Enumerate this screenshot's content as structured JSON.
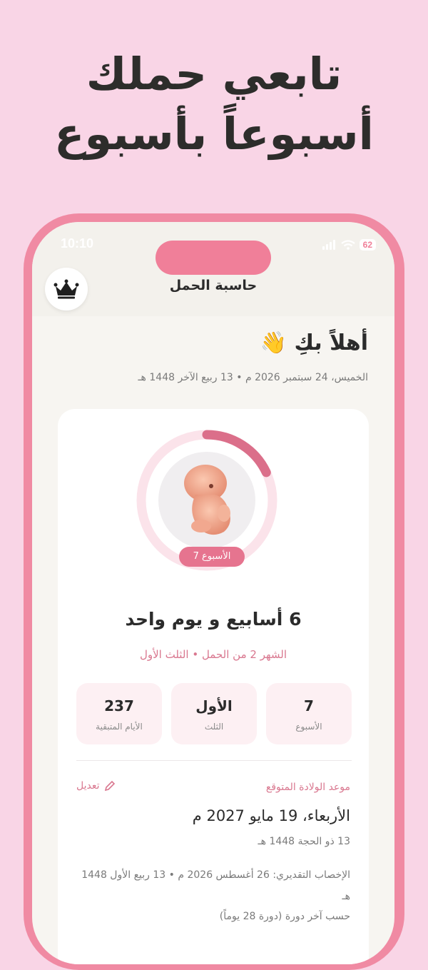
{
  "headline": {
    "line1": "تابعي حملك",
    "line2": "أسبوعاً بأسبوع"
  },
  "status_bar": {
    "time": "10:10",
    "battery": "62"
  },
  "app": {
    "title": "حاسبة الحمل",
    "crown_icon": "crown-icon"
  },
  "greeting": {
    "text": "أهلاً بكِ",
    "emoji": "👋"
  },
  "date_line": "الخميس، 24 سبتمبر 2026 م • 13 ربيع الآخر 1448 هـ",
  "progress": {
    "week_badge": "الأسبوع 7",
    "elapsed": "6 أسابيع و يوم واحد",
    "sub": "الشهر 2 من الحمل • الثلث الأول",
    "ring_fraction": 0.18,
    "ring_color": "#db6f8a",
    "ring_track_color": "#fbe3ea"
  },
  "stats": [
    {
      "value": "7",
      "label": "الأسبوع"
    },
    {
      "value": "الأول",
      "label": "الثلث"
    },
    {
      "value": "237",
      "label": "الأيام المتبقية"
    }
  ],
  "due": {
    "label": "موعد الولادة المتوقع",
    "edit": "تعديل",
    "date": "الأربعاء، 19 مايو 2027 م",
    "hijri": "13 ذو الحجة 1448 هـ",
    "conception": "الإخصاب التقديري: 26 أغسطس 2026 م • 13 ربيع الأول 1448 هـ",
    "cycle_note": "حسب آخر دورة (دورة 28 يوماً)"
  },
  "colors": {
    "background": "#f9d5e6",
    "accent": "#f08aa3",
    "pink_text": "#d9778f"
  }
}
